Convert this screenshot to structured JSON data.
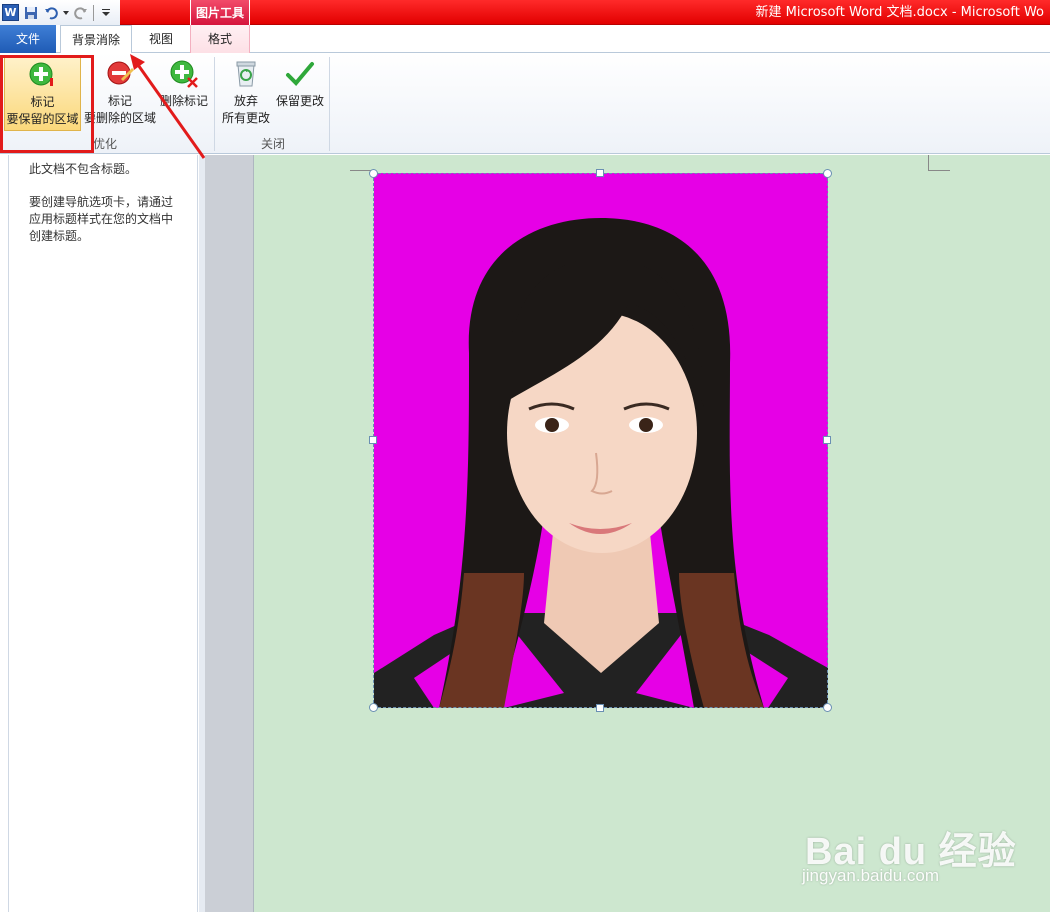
{
  "window": {
    "title": "新建 Microsoft Word 文档.docx - Microsoft Wo",
    "context_group": "图片工具"
  },
  "tabs": {
    "file": "文件",
    "background_removal": "背景消除",
    "view": "视图",
    "format": "格式"
  },
  "ribbon": {
    "mark_keep": {
      "line1": "标记",
      "line2": "要保留的区域",
      "icon": "plus-pencil-icon"
    },
    "mark_remove": {
      "line1": "标记",
      "line2": "要删除的区域",
      "icon": "minus-pencil-icon"
    },
    "delete_mark": {
      "line1": "删除标记",
      "icon": "delete-mark-icon"
    },
    "discard": {
      "line1": "放弃",
      "line2": "所有更改",
      "icon": "recycle-bin-icon"
    },
    "keep_changes": {
      "line1": "保留更改",
      "icon": "checkmark-icon"
    },
    "group_refine": "优化",
    "group_close": "关闭"
  },
  "nav_pane": {
    "no_headings": "此文档不包含标题。",
    "instructions": "要创建导航选项卡，请通过应用标题样式在您的文档中创建标题。"
  },
  "watermark": {
    "main": "Bai du 经验",
    "sub": "jingyan.baidu.com"
  },
  "colors": {
    "title_bar": "#e20000",
    "removed_background": "#e600e6",
    "page_background": "#cde7cf",
    "annotation_red": "#e21b1b"
  }
}
